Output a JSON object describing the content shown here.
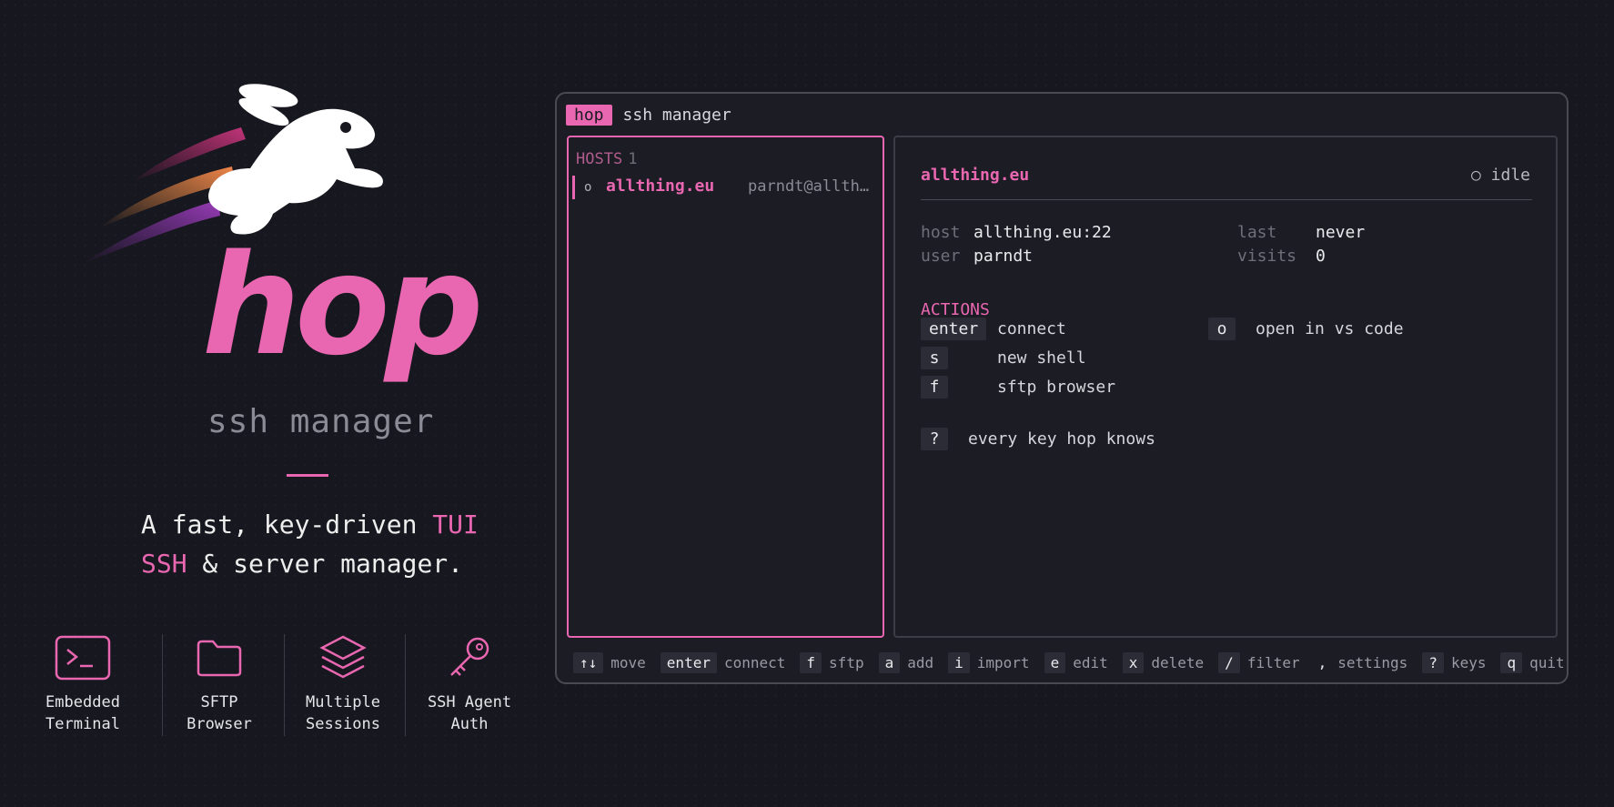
{
  "brand": {
    "word": "hop",
    "subtitle": "ssh manager",
    "tagline_part1": "A fast, key-driven ",
    "tagline_accent1": "TUI",
    "tagline_accent2": "SSH",
    "tagline_part2": " & server manager."
  },
  "features": [
    {
      "line1": "Embedded",
      "line2": "Terminal",
      "icon": "terminal-icon"
    },
    {
      "line1": "SFTP",
      "line2": "Browser",
      "icon": "folder-icon"
    },
    {
      "line1": "Multiple",
      "line2": "Sessions",
      "icon": "layers-icon"
    },
    {
      "line1": "SSH Agent",
      "line2": "Auth",
      "icon": "key-icon"
    }
  ],
  "window": {
    "badge": "hop",
    "title": "ssh manager"
  },
  "hosts": {
    "header": "HOSTS",
    "count": "1",
    "items": [
      {
        "status_glyph": "o",
        "name": "allthing.eu",
        "user": "parndt@allth…"
      }
    ]
  },
  "detail": {
    "name": "allthing.eu",
    "status": "○ idle",
    "host_label": "host",
    "host_value": "allthing.eu:22",
    "user_label": "user",
    "user_value": "parndt",
    "last_label": "last",
    "last_value": "never",
    "visits_label": "visits",
    "visits_value": "0",
    "actions_header": "ACTIONS",
    "actions": [
      {
        "key": "enter",
        "label": "connect"
      },
      {
        "key": "s",
        "label": "new shell"
      },
      {
        "key": "f",
        "label": "sftp browser"
      },
      {
        "key": "o",
        "label": "open in vs code"
      },
      {
        "key": "?",
        "label": "every key hop knows"
      }
    ]
  },
  "statusbar": [
    {
      "key": "↑↓",
      "label": "move"
    },
    {
      "key": "enter",
      "label": "connect"
    },
    {
      "key": "f",
      "label": "sftp"
    },
    {
      "key": "a",
      "label": "add"
    },
    {
      "key": "i",
      "label": "import"
    },
    {
      "key": "e",
      "label": "edit"
    },
    {
      "key": "x",
      "label": "delete"
    },
    {
      "key": "/",
      "label": "filter"
    },
    {
      "key": ",",
      "label": "settings"
    },
    {
      "key": "?",
      "label": "keys"
    },
    {
      "key": "q",
      "label": "quit"
    }
  ],
  "colors": {
    "accent": "#e967b0",
    "background": "#17171f",
    "panel": "#1c1c24"
  }
}
